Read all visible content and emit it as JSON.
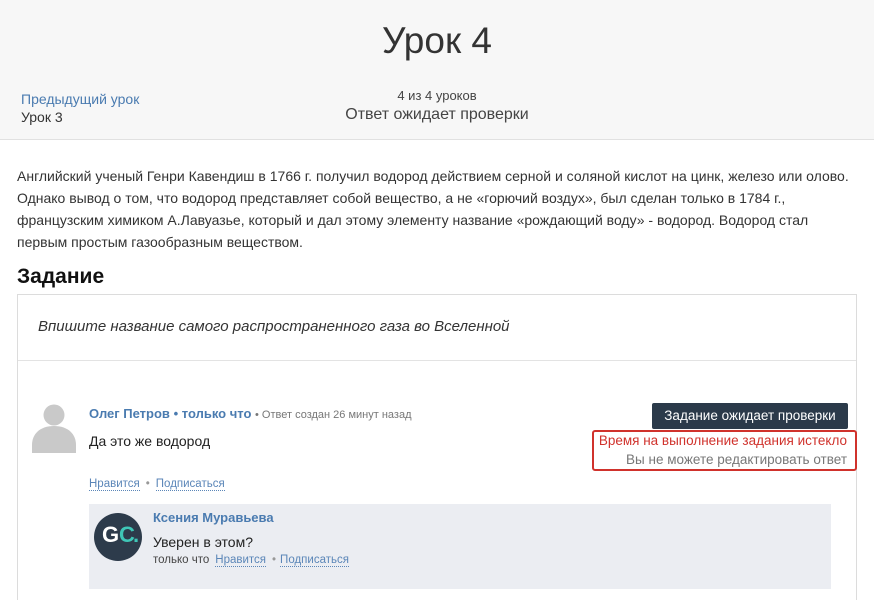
{
  "header": {
    "title": "Урок 4",
    "prev_link": "Предыдущий урок",
    "prev_name": "Урок 3",
    "counter": "4 из 4 уроков",
    "status": "Ответ ожидает проверки"
  },
  "content": {
    "text": "Английский ученый Генри Кавендиш в 1766 г. получил водород действием серной и соляной кислот на цинк, железо или олово. Однако вывод о том, что водород представляет собой вещество, а не «горючий воздух», был сделан только в 1784 г., французским химиком А.Лавуазье, который и дал этому элементу название «рождающий воду» - водород. Водород стал первым простым газообразным веществом."
  },
  "task": {
    "heading": "Задание",
    "question": "Впишите название самого распространенного газа во Вселенной"
  },
  "answer": {
    "author": "Олег Петров",
    "bullet": "•",
    "when": "только что",
    "meta": "• Ответ создан 26 минут назад",
    "text": "Да это же водород",
    "status_button": "Задание ожидает проверки",
    "expired": "Время на выполнение задания истекло",
    "no_edit": "Вы не можете редактировать ответ",
    "like": "Нравится",
    "subscribe": "Подписаться",
    "action_sep": "•"
  },
  "reply": {
    "author": "Ксения Муравьева",
    "text": "Уверен в этом?",
    "time": "только что",
    "like": "Нравится",
    "subscribe": "Подписаться",
    "sep": "•",
    "avatar_g": "G",
    "avatar_c": "C",
    "avatar_dot": "."
  },
  "colors": {
    "link": "#4a7bb0",
    "dark_button": "#2b3a4a",
    "warning": "#d0322c",
    "avatar_bg": "#2d3b4b",
    "avatar_accent": "#3fc6b7"
  },
  "icons": {
    "user_avatar": "user-silhouette-icon",
    "reply_avatar": "gc-logo-icon"
  }
}
